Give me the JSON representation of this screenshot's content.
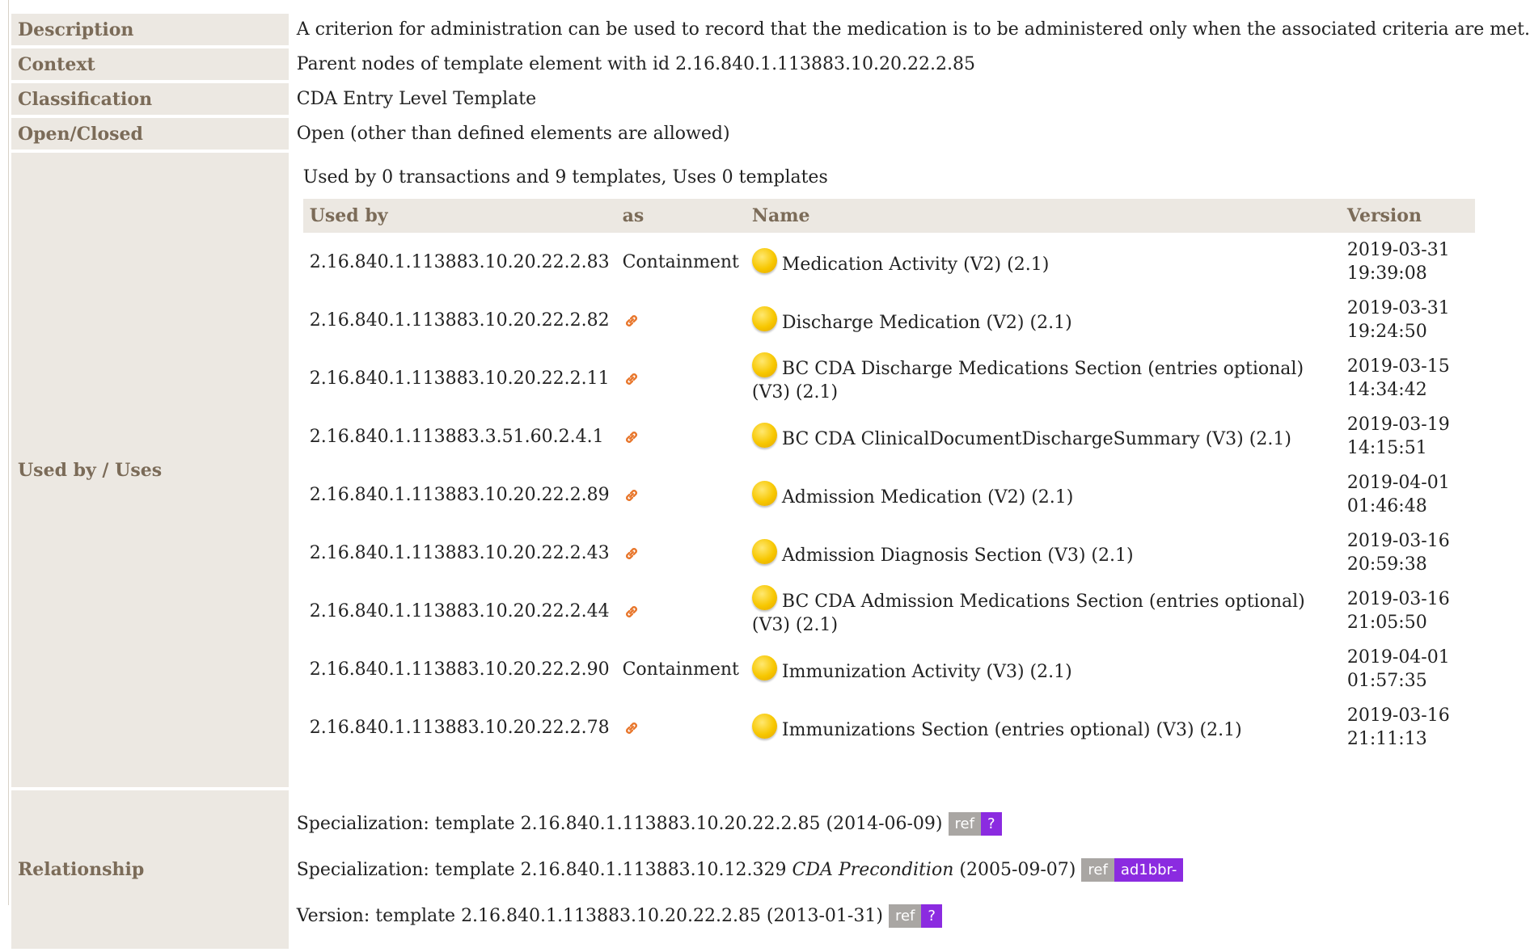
{
  "rows": {
    "description": {
      "label": "Description",
      "value": "A criterion for administration can be used to record that the medication is to be administered only when the associated criteria are met."
    },
    "context": {
      "label": "Context",
      "value": "Parent nodes of template element with id 2.16.840.1.113883.10.20.22.2.85"
    },
    "classification": {
      "label": "Classification",
      "value": "CDA Entry Level Template"
    },
    "open_closed": {
      "label": "Open/Closed",
      "value": "Open (other than defined elements are allowed)"
    },
    "used_by": {
      "label": "Used by / Uses",
      "summary": "Used by 0 transactions and 9 templates, Uses 0 templates"
    },
    "relationship": {
      "label": "Relationship"
    }
  },
  "used_table": {
    "headers": [
      "Used by",
      "as",
      "Name",
      "Version"
    ],
    "rows": [
      {
        "id": "2.16.840.1.113883.10.20.22.2.83",
        "as": "Containment",
        "name": "Medication Activity (V2) (2.1)",
        "date": "2019-03-31",
        "time": "19:39:08"
      },
      {
        "id": "2.16.840.1.113883.10.20.22.2.82",
        "as": "",
        "name": "Discharge Medication (V2) (2.1)",
        "date": "2019-03-31",
        "time": "19:24:50"
      },
      {
        "id": "2.16.840.1.113883.10.20.22.2.11",
        "as": "",
        "name": "BC CDA Discharge Medications Section (entries optional) (V3) (2.1)",
        "date": "2019-03-15",
        "time": "14:34:42"
      },
      {
        "id": "2.16.840.1.113883.3.51.60.2.4.1",
        "as": "",
        "name": "BC CDA ClinicalDocumentDischargeSummary (V3) (2.1)",
        "date": "2019-03-19",
        "time": "14:15:51"
      },
      {
        "id": "2.16.840.1.113883.10.20.22.2.89",
        "as": "",
        "name": "Admission Medication (V2) (2.1)",
        "date": "2019-04-01",
        "time": "01:46:48"
      },
      {
        "id": "2.16.840.1.113883.10.20.22.2.43",
        "as": "",
        "name": "Admission Diagnosis Section (V3) (2.1)",
        "date": "2019-03-16",
        "time": "20:59:38"
      },
      {
        "id": "2.16.840.1.113883.10.20.22.2.44",
        "as": "",
        "name": "BC CDA Admission Medications Section (entries optional) (V3) (2.1)",
        "date": "2019-03-16",
        "time": "21:05:50"
      },
      {
        "id": "2.16.840.1.113883.10.20.22.2.90",
        "as": "Containment",
        "name": "Immunization Activity (V3) (2.1)",
        "date": "2019-04-01",
        "time": "01:57:35"
      },
      {
        "id": "2.16.840.1.113883.10.20.22.2.78",
        "as": "",
        "name": "Immunizations Section (entries optional) (V3) (2.1)",
        "date": "2019-03-16",
        "time": "21:11:13"
      }
    ]
  },
  "relationships": [
    {
      "prefix": "Specialization: template 2.16.840.1.113883.10.20.22.2.85 (2014-06-09)",
      "italic": "",
      "suffix": "",
      "ref": "ref",
      "badge": "?"
    },
    {
      "prefix": "Specialization: template 2.16.840.1.113883.10.12.329 ",
      "italic": "CDA Precondition",
      "suffix": " (2005-09-07)",
      "ref": "ref",
      "badge": "ad1bbr-"
    },
    {
      "prefix": "Version: template 2.16.840.1.113883.10.20.22.2.85 (2013-01-31)",
      "italic": "",
      "suffix": "",
      "ref": "ref",
      "badge": "?"
    }
  ],
  "colors": {
    "label_bg": "#ece8e2",
    "label_text": "#7b6b58",
    "ref_badge": "#a9a6a3",
    "purple_badge": "#8b2be0",
    "link_icon": "#e8762b",
    "status_dot": "#f7c700"
  },
  "icons": {
    "status": "yellow-circle-icon",
    "link": "chain-link-icon"
  }
}
